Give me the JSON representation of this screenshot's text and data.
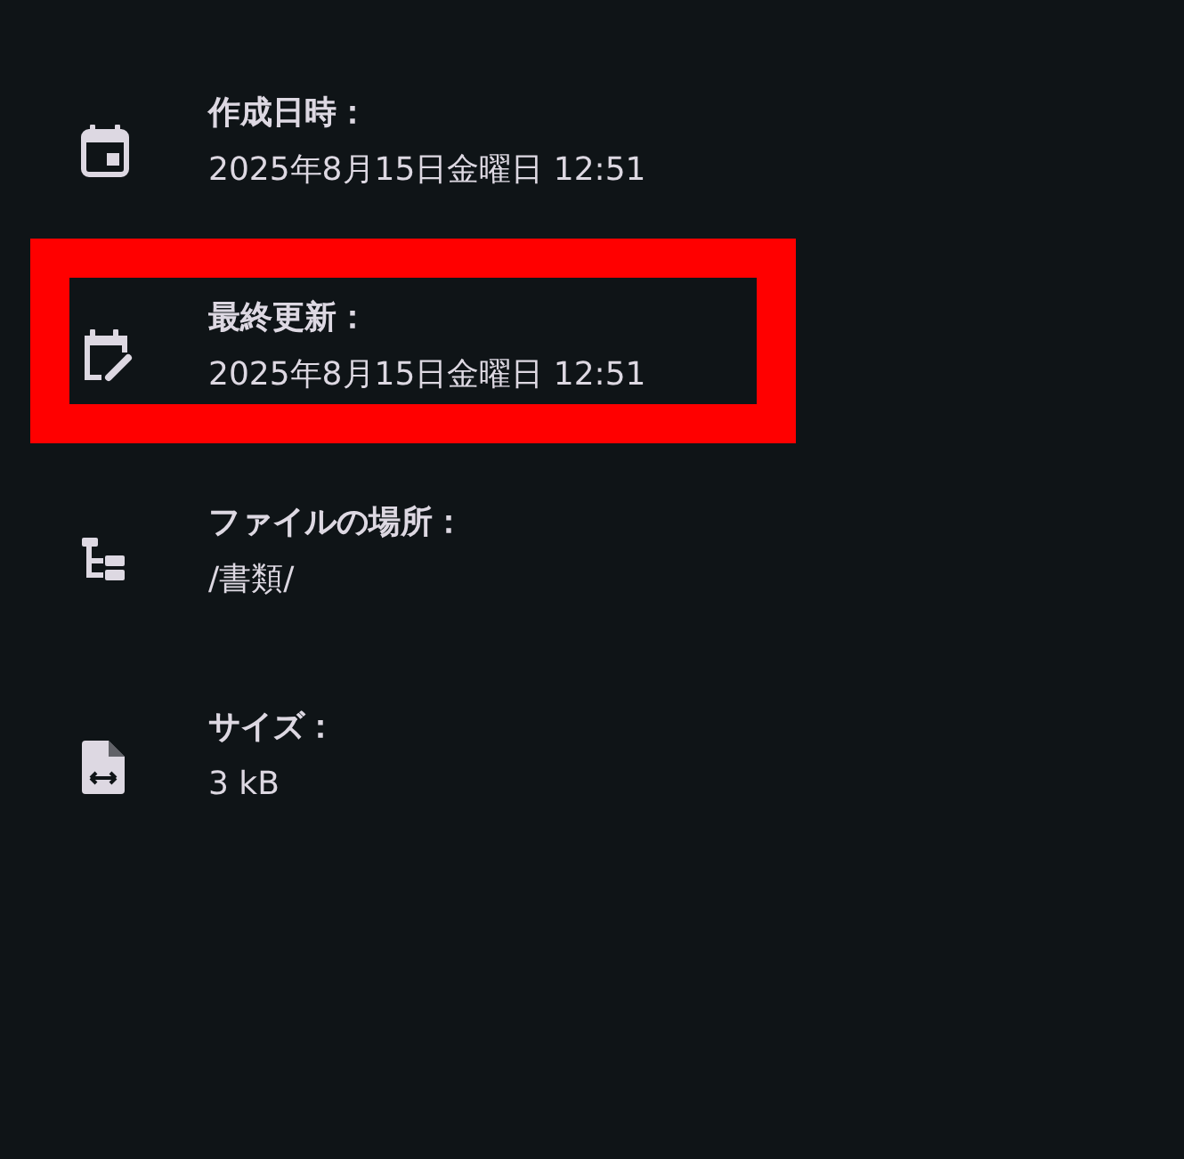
{
  "details": [
    {
      "kind": "created",
      "label": "作成日時：",
      "value": "2025年8月15日金曜日 12:51",
      "highlighted": false
    },
    {
      "kind": "modified",
      "label": "最終更新：",
      "value": "2025年8月15日金曜日 12:51",
      "highlighted": true
    },
    {
      "kind": "location",
      "label": "ファイルの場所：",
      "value": "/書類/",
      "highlighted": false
    },
    {
      "kind": "size",
      "label": "サイズ：",
      "value": "3 kB",
      "highlighted": false
    }
  ]
}
